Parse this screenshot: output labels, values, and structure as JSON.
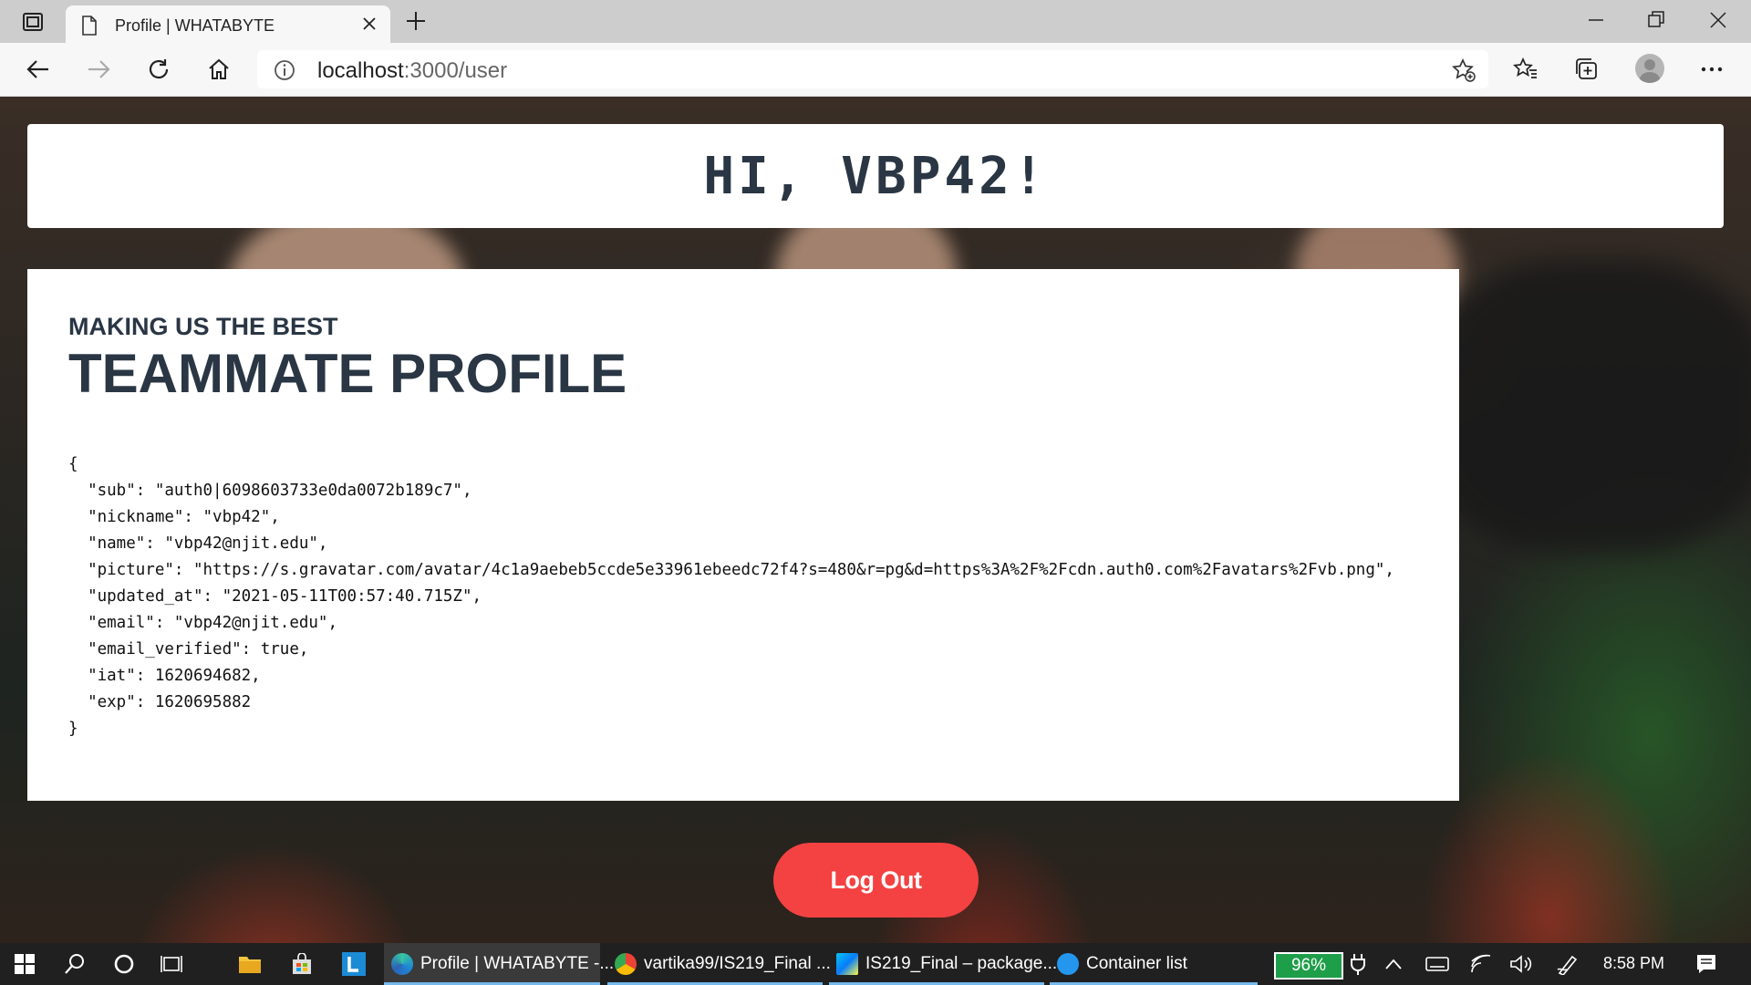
{
  "browser": {
    "tab_title": "Profile | WHATABYTE",
    "url_host": "localhost",
    "url_path": ":3000/user"
  },
  "page": {
    "greeting": "HI, VBP42!",
    "kicker": "MAKING US THE BEST",
    "headline": "TEAMMATE PROFILE",
    "profile_json": "{\n  \"sub\": \"auth0|6098603733e0da0072b189c7\",\n  \"nickname\": \"vbp42\",\n  \"name\": \"vbp42@njit.edu\",\n  \"picture\": \"https://s.gravatar.com/avatar/4c1a9aebeb5ccde5e33961ebeedc72f4?s=480&r=pg&d=https%3A%2F%2Fcdn.auth0.com%2Favatars%2Fvb.png\",\n  \"updated_at\": \"2021-05-11T00:57:40.715Z\",\n  \"email\": \"vbp42@njit.edu\",\n  \"email_verified\": true,\n  \"iat\": 1620694682,\n  \"exp\": 1620695882\n}",
    "logout_label": "Log Out",
    "logout_color": "#f44242"
  },
  "taskbar": {
    "apps": [
      {
        "label": "Profile | WHATABYTE -...",
        "icon": "edge-icon",
        "active": true
      },
      {
        "label": "vartika99/IS219_Final ...",
        "icon": "chrome-icon",
        "active": false
      },
      {
        "label": "IS219_Final – package...",
        "icon": "webstorm-icon",
        "active": false
      },
      {
        "label": "Container list",
        "icon": "docker-icon",
        "active": false
      }
    ],
    "battery": "96%",
    "time": "8:58 PM"
  }
}
